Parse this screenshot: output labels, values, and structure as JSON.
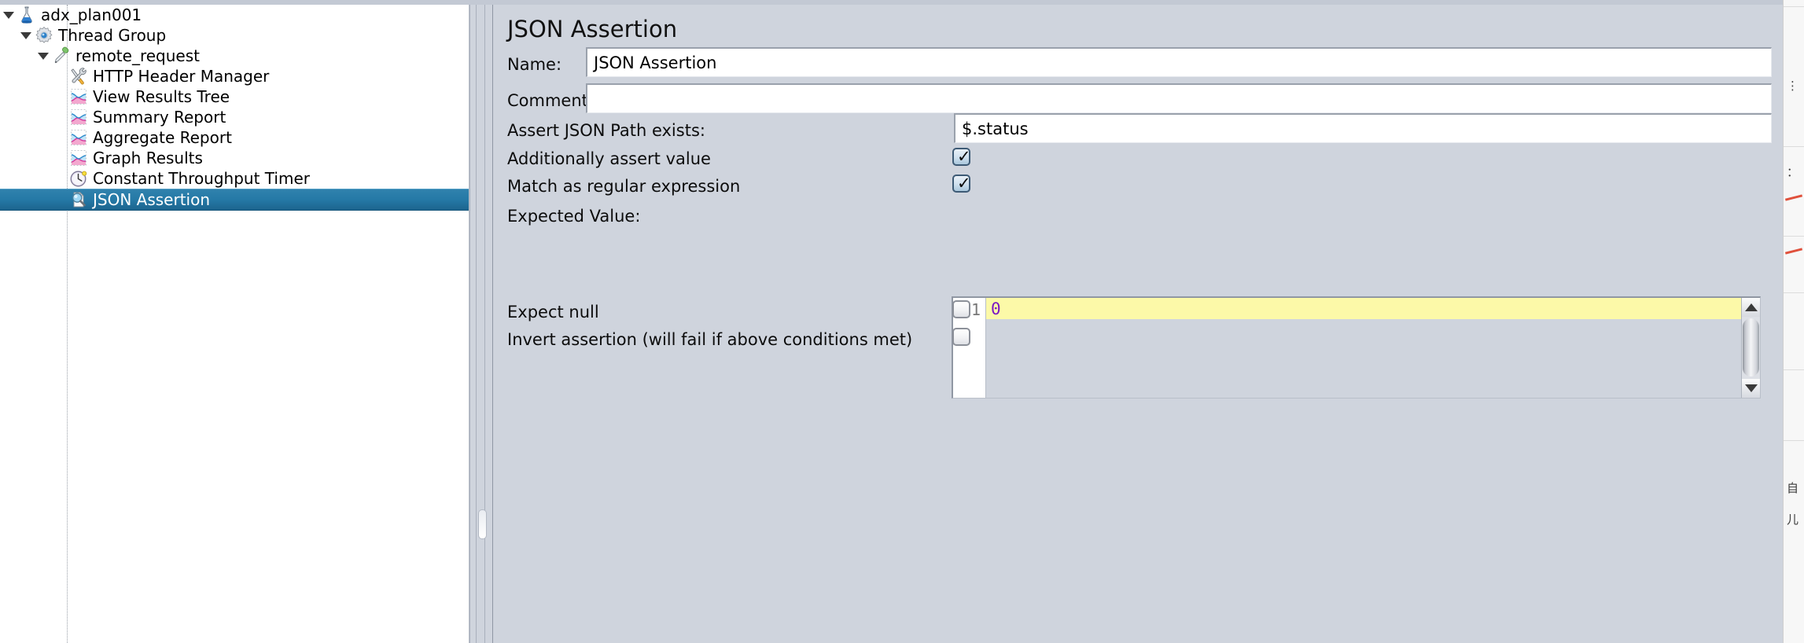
{
  "app": {
    "panel_title": "JSON Assertion"
  },
  "tree": {
    "nodes": [
      {
        "label": "adx_plan001",
        "icon": "flask-icon",
        "depth": 0,
        "expanded": true,
        "has_twisty": true,
        "selected": false
      },
      {
        "label": "Thread Group",
        "icon": "gear-icon",
        "depth": 1,
        "expanded": true,
        "has_twisty": true,
        "selected": false
      },
      {
        "label": "remote_request",
        "icon": "pipette-icon",
        "depth": 2,
        "expanded": true,
        "has_twisty": true,
        "selected": false
      },
      {
        "label": "HTTP Header Manager",
        "icon": "tools-icon",
        "depth": 3,
        "expanded": false,
        "has_twisty": false,
        "selected": false
      },
      {
        "label": "View Results Tree",
        "icon": "chart-icon",
        "depth": 3,
        "expanded": false,
        "has_twisty": false,
        "selected": false
      },
      {
        "label": "Summary Report",
        "icon": "chart-icon",
        "depth": 3,
        "expanded": false,
        "has_twisty": false,
        "selected": false
      },
      {
        "label": "Aggregate Report",
        "icon": "chart-icon",
        "depth": 3,
        "expanded": false,
        "has_twisty": false,
        "selected": false
      },
      {
        "label": "Graph Results",
        "icon": "chart-icon",
        "depth": 3,
        "expanded": false,
        "has_twisty": false,
        "selected": false
      },
      {
        "label": "Constant Throughput Timer",
        "icon": "clock-icon",
        "depth": 3,
        "expanded": false,
        "has_twisty": false,
        "selected": false
      },
      {
        "label": "JSON Assertion",
        "icon": "magnifier-icon",
        "depth": 3,
        "expanded": false,
        "has_twisty": false,
        "selected": true
      }
    ]
  },
  "form": {
    "name": {
      "label": "Name:",
      "value": "JSON Assertion"
    },
    "comments": {
      "label": "Comments:",
      "value": ""
    },
    "json_path": {
      "label": "Assert JSON Path exists:",
      "value": "$.status"
    },
    "additionally_assert_value": {
      "label": "Additionally assert value",
      "checked": true,
      "mark": "✓"
    },
    "match_regex": {
      "label": "Match as regular expression",
      "checked": true,
      "mark": "✓"
    },
    "expected_value": {
      "label": "Expected Value:",
      "line_number": "1",
      "value": "0"
    },
    "expect_null": {
      "label": "Expect null",
      "checked": false
    },
    "invert_assertion": {
      "label": "Invert assertion (will fail if above conditions met)",
      "checked": false
    }
  },
  "colors": {
    "panel_bg": "#cfd4dd",
    "tree_bg": "#ffffff",
    "selection": "#2579a6",
    "current_line": "#fcf9a8",
    "number_token": "#7b16c4"
  }
}
